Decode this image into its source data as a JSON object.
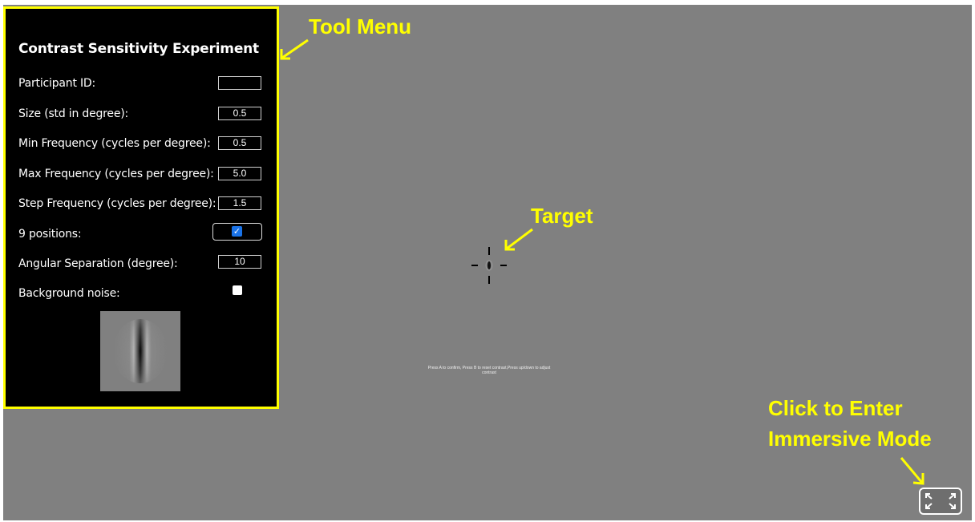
{
  "panel": {
    "title": "Contrast Sensitivity Experiment",
    "fields": [
      {
        "label": "Participant ID:",
        "value": ""
      },
      {
        "label": "Size (std in degree):",
        "value": "0.5"
      },
      {
        "label": "Min Frequency (cycles per degree):",
        "value": "0.5"
      },
      {
        "label": "Max Frequency (cycles per degree):",
        "value": "5.0"
      },
      {
        "label": "Step Frequency (cycles per degree):",
        "value": "1.5"
      }
    ],
    "nine_positions": {
      "label": "9 positions:",
      "checked": true
    },
    "angular_separation": {
      "label": "Angular Separation (degree):",
      "value": "10"
    },
    "background_noise": {
      "label": "Background noise:",
      "checked": false
    }
  },
  "annotations": {
    "tool_menu": "Tool Menu",
    "target": "Target",
    "immersive_line1": "Click to Enter",
    "immersive_line2": "Immersive Mode"
  },
  "instruction": "Press A to confirm, Press B to reset contrast,Press up/down to adjust contrast",
  "colors": {
    "background": "#808080",
    "panel": "#000000",
    "annotation": "#ffff00",
    "checkbox_accent": "#1a73e8"
  },
  "icons": {
    "fullscreen": "expand-arrows-icon",
    "checkbox": "check-icon"
  }
}
